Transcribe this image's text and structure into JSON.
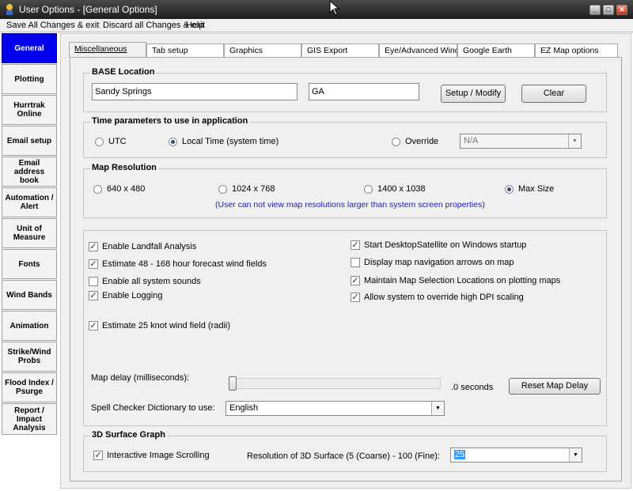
{
  "window": {
    "title": "User Options - [General Options]"
  },
  "menu": [
    "Save All Changes & exit",
    "Discard all Changes & exit",
    "Help"
  ],
  "sidebar": [
    {
      "label": "General",
      "active": true
    },
    {
      "label": "Plotting"
    },
    {
      "label": "Hurrtrak Online"
    },
    {
      "label": "Email setup"
    },
    {
      "label": "Email address book"
    },
    {
      "label": "Automation / Alert"
    },
    {
      "label": "Unit of Measure"
    },
    {
      "label": "Fonts"
    },
    {
      "label": "Wind Bands"
    },
    {
      "label": "Animation"
    },
    {
      "label": "Strike/Wind Probs"
    },
    {
      "label": "Flood Index / Psurge"
    },
    {
      "label": "Report / Impact Analysis"
    }
  ],
  "tabs": [
    "Miscellaneous",
    "Tab setup",
    "Graphics",
    "GIS Export",
    "Eye/Advanced Wind E",
    "Google Earth",
    "EZ Map options"
  ],
  "base_location": {
    "title": "BASE Location",
    "city": "Sandy Springs",
    "state": "GA",
    "setup_button": "Setup / Modify",
    "clear_button": "Clear"
  },
  "time_params": {
    "title": "Time parameters to use in application",
    "utc": "UTC",
    "local": "Local Time (system time)",
    "override": "Override",
    "override_value": "N/A",
    "selected": "local"
  },
  "map_resolution": {
    "title": "Map Resolution",
    "options": [
      "640 x 480",
      "1024 x 768",
      "1400 x 1038",
      "Max Size"
    ],
    "selected": "Max Size",
    "note": "(User can not view map resolutions larger than system screen properties)"
  },
  "options": {
    "left": [
      {
        "label": "Enable Landfall Analysis",
        "checked": true
      },
      {
        "label": "Estimate 48 - 168 hour forecast wind fields",
        "checked": true
      },
      {
        "label": "Enable all system sounds",
        "checked": false
      },
      {
        "label": "Enable Logging",
        "checked": true
      },
      {
        "label": "Estimate 25 knot wind field (radii)",
        "checked": true
      }
    ],
    "right": [
      {
        "label": "Start DesktopSatellite on Windows startup",
        "checked": true
      },
      {
        "label": "Display map navigation arrows on map",
        "checked": false
      },
      {
        "label": "Maintain Map Selection Locations on plotting maps",
        "checked": true
      },
      {
        "label": "Allow system to override high DPI scaling",
        "checked": true
      }
    ]
  },
  "map_delay": {
    "label": "Map delay (milliseconds):",
    "value_text": ".0 seconds",
    "reset_button": "Reset Map Delay"
  },
  "spell": {
    "label": "Spell Checker Dictionary to use:",
    "value": "English"
  },
  "surface": {
    "title": "3D Surface Graph",
    "scroll_label": "Interactive Image Scrolling",
    "scroll_checked": true,
    "resolution_label": "Resolution of 3D Surface (5 (Coarse) - 100 (Fine):",
    "resolution_value": "25"
  }
}
